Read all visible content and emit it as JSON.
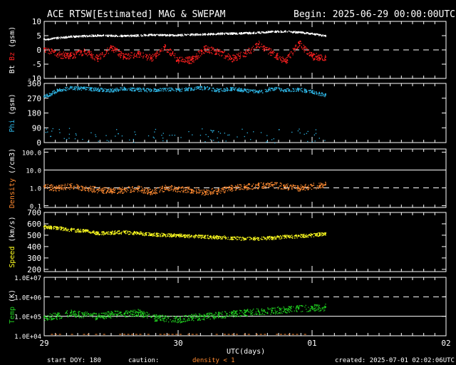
{
  "header": {
    "title": "ACE RTSW[Estimated] MAG & SWEPAM",
    "begin": "Begin: 2025-06-29 00:00:00UTC"
  },
  "footer": {
    "start_doy": "start DOY: 180",
    "caution": "caution:",
    "density_caution": "density < 1",
    "created": "created: 2025-07-01 02:02:06UTC",
    "xlabel": "UTC(days)"
  },
  "colors": {
    "bt": "#ffffff",
    "bz": "#ff2020",
    "phi": "#2fb8e8",
    "density": "#ff8a30",
    "speed": "#ffff20",
    "temp": "#20d020",
    "frame": "#ffffff"
  },
  "chart_data": [
    {
      "type": "scatter",
      "name": "mag",
      "ylabel_parts": [
        "Bt",
        "Bz",
        "(gsm)"
      ],
      "ylim": [
        -10,
        10
      ],
      "yticks": [
        10,
        5,
        0,
        -5,
        -10
      ],
      "ref_lines": [
        {
          "y": 0,
          "style": "dashed"
        }
      ],
      "series": [
        {
          "name": "Bt",
          "x": [
            0,
            0.1,
            0.2,
            0.3,
            0.4,
            0.5,
            0.6,
            0.7,
            0.8,
            0.9,
            1.0,
            1.1,
            1.2,
            1.3,
            1.4,
            1.5,
            1.6,
            1.7,
            1.8,
            1.9,
            2.0,
            2.1
          ],
          "y": [
            3.8,
            4.3,
            4.8,
            5.0,
            5.2,
            5.1,
            5.0,
            5.2,
            5.4,
            5.3,
            5.3,
            5.5,
            5.6,
            5.8,
            5.9,
            6.0,
            6.2,
            6.5,
            6.6,
            6.3,
            5.8,
            5.0
          ]
        },
        {
          "name": "Bz",
          "x": [
            0,
            0.1,
            0.2,
            0.3,
            0.4,
            0.5,
            0.6,
            0.7,
            0.8,
            0.9,
            1.0,
            1.1,
            1.2,
            1.3,
            1.4,
            1.5,
            1.6,
            1.7,
            1.8,
            1.9,
            2.0,
            2.1
          ],
          "y": [
            0.5,
            -1.5,
            -2.0,
            -0.5,
            -3.0,
            0.8,
            -2.5,
            -1.2,
            -2.8,
            1.0,
            -3.5,
            -3.5,
            0.5,
            -0.5,
            -3.0,
            -1.2,
            2.0,
            -1.0,
            -4.0,
            2.5,
            -2.2,
            -2.5
          ]
        }
      ]
    },
    {
      "type": "scatter",
      "name": "phi",
      "ylabel_parts": [
        "Phi",
        "(gsm)"
      ],
      "ylim": [
        0,
        360
      ],
      "yticks": [
        360,
        270,
        180,
        90,
        0
      ],
      "series": [
        {
          "name": "Phi",
          "x": [
            0,
            0.1,
            0.2,
            0.3,
            0.4,
            0.5,
            0.6,
            0.7,
            0.8,
            0.9,
            1.0,
            1.1,
            1.2,
            1.3,
            1.4,
            1.5,
            1.6,
            1.7,
            1.8,
            1.9,
            2.0,
            2.1
          ],
          "y": [
            280,
            320,
            335,
            330,
            325,
            320,
            330,
            325,
            320,
            328,
            322,
            330,
            335,
            320,
            330,
            320,
            310,
            330,
            320,
            325,
            310,
            290
          ]
        }
      ]
    },
    {
      "type": "scatter",
      "name": "density",
      "ylabel_parts": [
        "Density",
        "(/cm3)"
      ],
      "yscale": "log",
      "ylim": [
        0.08,
        150
      ],
      "yticks": [
        100.0,
        10.0,
        1.0,
        0.1
      ],
      "ytick_labels": [
        "100.0",
        "10.0",
        "1.0",
        "0.1"
      ],
      "ref_lines": [
        {
          "y": 10,
          "style": "solid"
        },
        {
          "y": 1,
          "style": "dashed"
        }
      ],
      "series": [
        {
          "name": "Density",
          "x": [
            0,
            0.1,
            0.2,
            0.3,
            0.4,
            0.5,
            0.6,
            0.7,
            0.8,
            0.9,
            1.0,
            1.1,
            1.2,
            1.3,
            1.4,
            1.5,
            1.6,
            1.7,
            1.8,
            1.9,
            2.0,
            2.1
          ],
          "y": [
            1.2,
            1.0,
            1.3,
            1.0,
            0.8,
            0.7,
            0.8,
            0.9,
            0.6,
            1.0,
            0.9,
            0.8,
            0.6,
            0.7,
            1.0,
            1.2,
            1.4,
            1.5,
            1.2,
            1.0,
            1.3,
            1.5
          ]
        }
      ]
    },
    {
      "type": "scatter",
      "name": "speed",
      "ylabel_parts": [
        "Speed",
        "(km/s)"
      ],
      "ylim": [
        180,
        700
      ],
      "yticks": [
        700,
        600,
        500,
        400,
        300,
        200
      ],
      "series": [
        {
          "name": "Speed",
          "x": [
            0,
            0.1,
            0.2,
            0.3,
            0.4,
            0.5,
            0.6,
            0.7,
            0.8,
            0.9,
            1.0,
            1.1,
            1.2,
            1.3,
            1.4,
            1.5,
            1.6,
            1.7,
            1.8,
            1.9,
            2.0,
            2.1
          ],
          "y": [
            575,
            565,
            550,
            540,
            520,
            525,
            530,
            520,
            510,
            505,
            500,
            495,
            490,
            485,
            480,
            470,
            475,
            480,
            490,
            495,
            505,
            515
          ]
        }
      ]
    },
    {
      "type": "scatter",
      "name": "temp",
      "ylabel_parts": [
        "Temp",
        "(K)"
      ],
      "yscale": "log",
      "ylim": [
        10000,
        10000000
      ],
      "yticks": [
        10000000,
        1000000,
        100000,
        10000
      ],
      "ytick_labels": [
        "1.0E+07",
        "1.0E+06",
        "1.0E+05",
        "1.0E+04"
      ],
      "ref_lines": [
        {
          "y": 1000000,
          "style": "dashed"
        },
        {
          "y": 100000,
          "style": "solid"
        }
      ],
      "series": [
        {
          "name": "Temp",
          "x": [
            0,
            0.1,
            0.2,
            0.3,
            0.4,
            0.5,
            0.6,
            0.7,
            0.8,
            0.9,
            1.0,
            1.1,
            1.2,
            1.3,
            1.4,
            1.5,
            1.6,
            1.7,
            1.8,
            1.9,
            2.0,
            2.1
          ],
          "y": [
            90000,
            110000,
            150000,
            120000,
            100000,
            130000,
            140000,
            160000,
            90000,
            80000,
            70000,
            90000,
            100000,
            120000,
            140000,
            160000,
            180000,
            200000,
            230000,
            260000,
            280000,
            300000
          ]
        }
      ]
    }
  ],
  "xaxis": {
    "range": [
      0,
      3
    ],
    "ticks": [
      0,
      1,
      2,
      3
    ],
    "tick_labels": [
      "29",
      "30",
      "01",
      "02"
    ]
  }
}
